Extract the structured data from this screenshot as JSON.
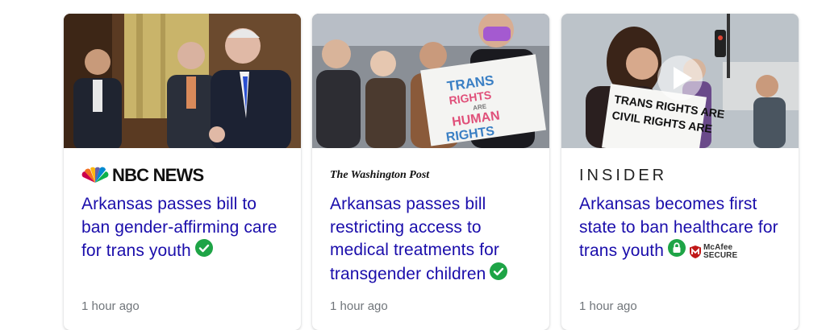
{
  "cards": [
    {
      "source": "NBC NEWS",
      "source_logo": "nbc-peacock-icon",
      "headline": "Arkansas passes bill to ban gender-affirming care for trans youth",
      "verified": true,
      "time": "1 hour ago"
    },
    {
      "source": "The Washington Post",
      "headline": "Arkansas passes bill restricting access to medical treatments for transgender children",
      "verified": true,
      "time": "1 hour ago",
      "image_sign": [
        "TRANS",
        "RIGHTS",
        "ARE",
        "HUMAN",
        "RIGHTS"
      ]
    },
    {
      "source": "INSIDER",
      "headline": "Arkansas becomes first state to ban healthcare for trans youth",
      "secure_badge": [
        "McAfee",
        "SECURE"
      ],
      "time": "1 hour ago",
      "image_sign": [
        "TRANS RIGHTS ARE",
        "CIVIL RIGHTS ARE"
      ],
      "has_video": true
    }
  ],
  "colors": {
    "headline": "#1a0dab",
    "meta": "#70757a",
    "verified_green": "#1ea446",
    "mcafee_red": "#c01818"
  }
}
